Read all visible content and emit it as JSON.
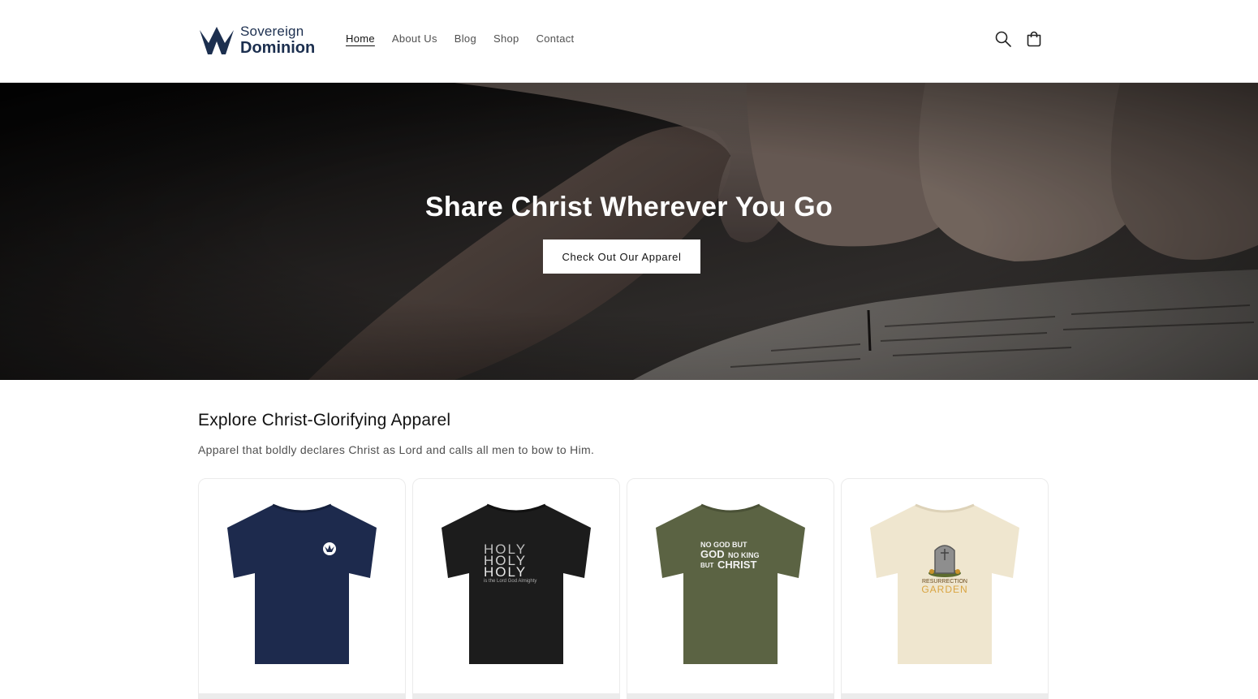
{
  "brand": {
    "line1": "Sovereign",
    "line2": "Dominion"
  },
  "nav": [
    {
      "label": "Home",
      "active": true
    },
    {
      "label": "About Us"
    },
    {
      "label": "Blog"
    },
    {
      "label": "Shop"
    },
    {
      "label": "Contact"
    }
  ],
  "header_icons": [
    "search-icon",
    "cart-icon"
  ],
  "hero": {
    "title": "Share Christ Wherever You Go",
    "button": "Check Out Our Apparel"
  },
  "collection": {
    "title": "Explore Christ-Glorifying Apparel",
    "subtitle": "Apparel that boldly declares Christ as Lord and calls all men to bow to Him.",
    "products": [
      {
        "shirt_color": "#1d2a4d",
        "print": [
          "crown logo"
        ]
      },
      {
        "shirt_color": "#1c1c1c",
        "print": [
          "HOLY",
          "HOLY",
          "HOLY",
          "is the Lord God Almighty"
        ]
      },
      {
        "shirt_color": "#5b6343",
        "print": [
          "NO GOD BUT",
          "GOD",
          "NO KING",
          "BUT",
          "CHRIST"
        ]
      },
      {
        "shirt_color": "#efe6cf",
        "print": [
          "RESURRECTION",
          "GARDEN"
        ]
      }
    ]
  },
  "colors": {
    "brand": "#1c2f4f",
    "text": "#121212",
    "muted": "#505050"
  }
}
